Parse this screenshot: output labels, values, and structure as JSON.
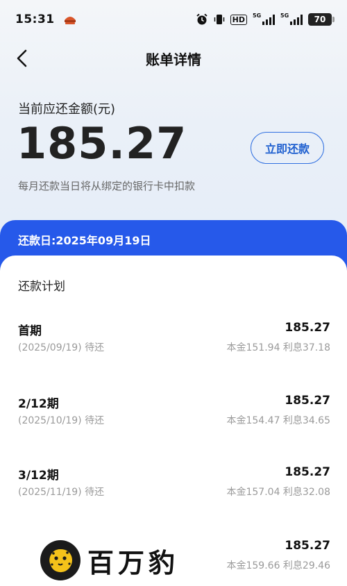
{
  "status_bar": {
    "time": "15:31",
    "hd_label": "HD",
    "net1": "5G",
    "net2": "5G",
    "battery": "70"
  },
  "nav": {
    "title": "账单详情"
  },
  "summary": {
    "label": "当前应还金额(元)",
    "amount": "185.27",
    "pay_button": "立即还款",
    "note": "每月还款当日将从绑定的银行卡中扣款"
  },
  "due": {
    "text": "还款日:2025年09月19日"
  },
  "plan": {
    "title": "还款计划",
    "rows": [
      {
        "term": "首期",
        "amount": "185.27",
        "date_status": "(2025/09/19) 待还",
        "detail": "本金151.94 利息37.18"
      },
      {
        "term": "2/12期",
        "amount": "185.27",
        "date_status": "(2025/10/19) 待还",
        "detail": "本金154.47 利息34.65"
      },
      {
        "term": "3/12期",
        "amount": "185.27",
        "date_status": "(2025/11/19) 待还",
        "detail": "本金157.04 利息32.08"
      },
      {
        "term": "",
        "amount": "185.27",
        "date_status": "",
        "detail": "本金159.66 利息29.46"
      }
    ]
  },
  "brand": {
    "name": "百万豹"
  },
  "colors": {
    "accent_blue": "#2659ea",
    "button_blue": "#1e5fcf",
    "muted_text": "#9a9a9a"
  }
}
